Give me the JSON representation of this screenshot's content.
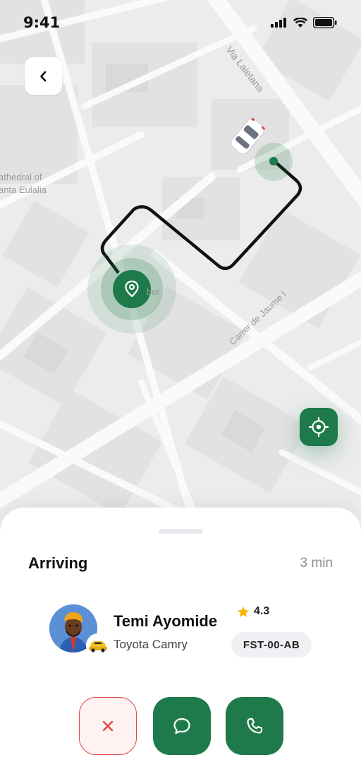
{
  "status_bar": {
    "time": "9:41"
  },
  "map": {
    "street_labels": [
      "Via Laietana",
      "Carrer de Jaume I"
    ],
    "place_label_line1": "athedral of",
    "place_label_line2": "anta Eulalia",
    "poi_fragment": "ber"
  },
  "trip": {
    "status": "Arriving",
    "eta": "3 min"
  },
  "driver": {
    "name": "Temi Ayomide",
    "rating": "4.3",
    "car": "Toyota Camry",
    "plate": "FST-00-AB"
  },
  "colors": {
    "primary": "#1e7a4a",
    "danger": "#e04646",
    "star": "#f5b400"
  }
}
